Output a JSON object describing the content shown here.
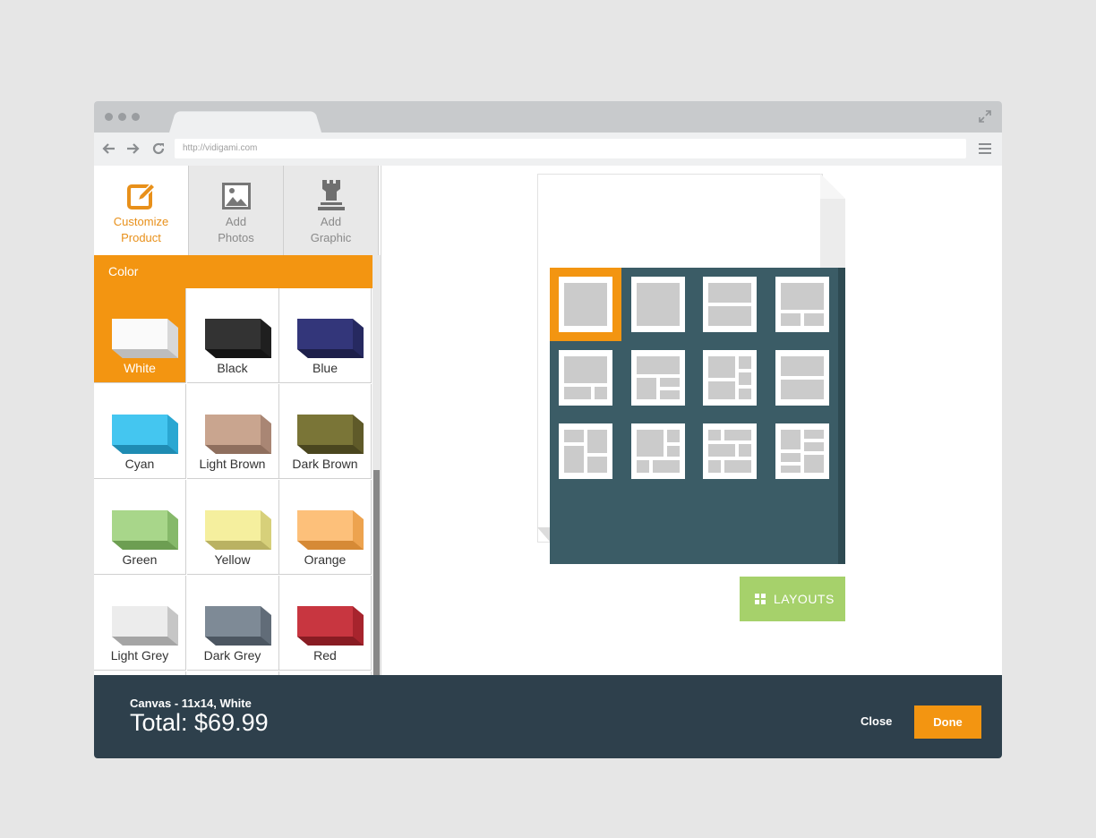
{
  "browser": {
    "url": "http://vidigami.com"
  },
  "sidebar": {
    "tabs": [
      {
        "label_line1": "Customize",
        "label_line2": "Product",
        "icon": "edit-icon"
      },
      {
        "label_line1": "Add",
        "label_line2": "Photos",
        "icon": "image-icon"
      },
      {
        "label_line1": "Add",
        "label_line2": "Graphic",
        "icon": "rook-icon"
      }
    ],
    "section_title": "Color",
    "colors": [
      {
        "name": "White",
        "top": "#fafafa",
        "side": "#d8d8d8",
        "bottom": "#bdbdbd"
      },
      {
        "name": "Black",
        "top": "#333333",
        "side": "#1f1f1f",
        "bottom": "#141414"
      },
      {
        "name": "Blue",
        "top": "#33367a",
        "side": "#262960",
        "bottom": "#1d1f4a"
      },
      {
        "name": "Cyan",
        "top": "#44c6f0",
        "side": "#2aa7d2",
        "bottom": "#1f8cb3"
      },
      {
        "name": "Light Brown",
        "top": "#c9a58f",
        "side": "#a98674",
        "bottom": "#8f6f5e"
      },
      {
        "name": "Dark Brown",
        "top": "#7a7537",
        "side": "#5f5a29",
        "bottom": "#4a461f"
      },
      {
        "name": "Green",
        "top": "#a8d68a",
        "side": "#86b96a",
        "bottom": "#6d9e52"
      },
      {
        "name": "Yellow",
        "top": "#f5ef9e",
        "side": "#d7d07a",
        "bottom": "#bab262"
      },
      {
        "name": "Orange",
        "top": "#fdc07a",
        "side": "#eda34f",
        "bottom": "#d68a36"
      },
      {
        "name": "Light Grey",
        "top": "#ececec",
        "side": "#c6c6c6",
        "bottom": "#a5a5a5"
      },
      {
        "name": "Dark Grey",
        "top": "#7e8a96",
        "side": "#616c78",
        "bottom": "#4c5661"
      },
      {
        "name": "Red",
        "top": "#c83640",
        "side": "#a7242d",
        "bottom": "#881c23"
      }
    ]
  },
  "layouts_button": "LAYOUTS",
  "footer": {
    "product": "Canvas - 11x14, White",
    "total": "Total: $69.99",
    "close": "Close",
    "done": "Done"
  }
}
